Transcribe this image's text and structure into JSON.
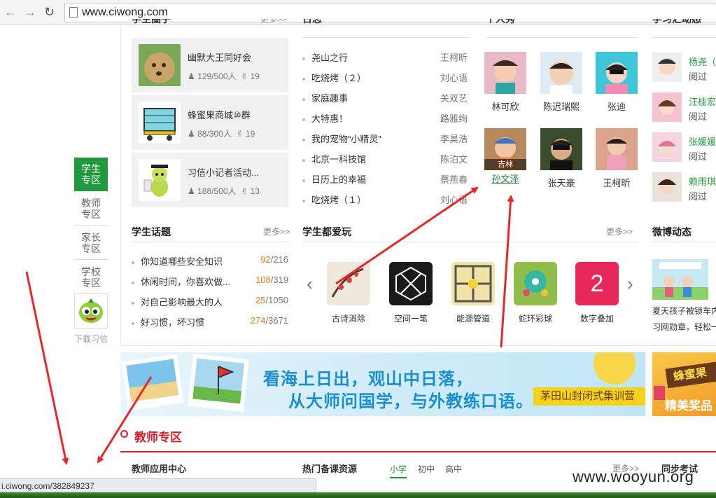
{
  "browser": {
    "url": "www.ciwong.com",
    "status_url": "i.ciwong.com/382849237",
    "back_icon": "arrow-left-icon",
    "forward_icon": "arrow-right-icon",
    "reload_icon": "reload-icon"
  },
  "student_groups": {
    "header_partial": "学生圈子",
    "more": "更多>>",
    "items": [
      {
        "name": "幽默大王同好会",
        "members": "129/500人",
        "likes": "19"
      },
      {
        "name": "蜂蜜果商城⑩群",
        "members": "88/300人",
        "likes": "19"
      },
      {
        "name": "习信小记者活动...",
        "members": "188/500人",
        "likes": "13"
      }
    ]
  },
  "diary": {
    "header_partial": "日志",
    "items": [
      {
        "title": "尧山之行",
        "author": "王柯昕"
      },
      {
        "title": "吃烧烤（２）",
        "author": "刘心语"
      },
      {
        "title": "家庭趣事",
        "author": "关双艺"
      },
      {
        "title": "大特惠！",
        "author": "路雅绚"
      },
      {
        "title": "我的宠物“小精灵”",
        "author": "李昊浩"
      },
      {
        "title": "北京一科技馆",
        "author": "陈泊文"
      },
      {
        "title": "日历上的幸福",
        "author": "蔡燕春"
      },
      {
        "title": "吃烧烤（１）",
        "author": "刘心语"
      }
    ]
  },
  "people": {
    "header_partial": "个人秀",
    "items": [
      {
        "name": "林可欣",
        "caption": ""
      },
      {
        "name": "陈迟瑞熙",
        "caption": ""
      },
      {
        "name": "张迪",
        "caption": ""
      },
      {
        "name": "孙文泽",
        "caption": "吉林"
      },
      {
        "name": "张天豪",
        "caption": ""
      },
      {
        "name": "王柯昕",
        "caption": ""
      }
    ]
  },
  "feed": {
    "header_partial": "学习汇动态",
    "items": [
      {
        "name": "杨尧（",
        "verb": "阅过"
      },
      {
        "name": "汪桂宏",
        "verb": "阅过"
      },
      {
        "name": "张媛媛",
        "verb": "阅过"
      },
      {
        "name": "赖雨琪",
        "verb": "阅过"
      }
    ]
  },
  "topics": {
    "header": "学生话题",
    "more": "更多>>",
    "items": [
      {
        "title": "你知道哪些安全知识",
        "hot": "92",
        "total": "/216"
      },
      {
        "title": "休闲时间，你喜欢做...",
        "hot": "108",
        "total": "/319"
      },
      {
        "title": "对自己影响最大的人",
        "hot": "25",
        "total": "/1050"
      },
      {
        "title": "好习惯，坏习惯",
        "hot": "274",
        "total": "/3671"
      }
    ]
  },
  "games": {
    "header": "学生都爱玩",
    "more": "更多>>",
    "items": [
      "古诗消除",
      "空间一笔",
      "能源管道",
      "蛇环彩球",
      "数字叠加"
    ],
    "number_game_label": "2"
  },
  "weibo": {
    "header": "微博动态",
    "text_line1": "夏天孩子被锁车内",
    "text_line2": "习网勋章，轻松一"
  },
  "sidebar": {
    "items": [
      {
        "line1": "学生",
        "line2": "专区"
      },
      {
        "line1": "教师",
        "line2": "专区"
      },
      {
        "line1": "家长",
        "line2": "专区"
      },
      {
        "line1": "学校",
        "line2": "专区"
      }
    ],
    "download_label": "下载习信"
  },
  "banner": {
    "line1": "看海上日出，观山中日落，",
    "line2": "从大师问国学，与外教练口语。",
    "tag": "茅田山封闭式集训营",
    "side_line1": "蜂蜜果",
    "side_line2": "精美奖品"
  },
  "teacher": {
    "title": "教师专区",
    "app_center": "教师应用中心",
    "resources": "热门备课资源",
    "tabs": [
      "小学",
      "初中",
      "高中"
    ],
    "more": "更多>>",
    "sync_exam": "同步考试"
  },
  "watermark": "www.wooyun.org",
  "colors": {
    "brand_green": "#1e9a3c",
    "accent_red": "#d9202a",
    "hot_orange": "#f37d1b",
    "annotation_red": "#e8262b"
  }
}
